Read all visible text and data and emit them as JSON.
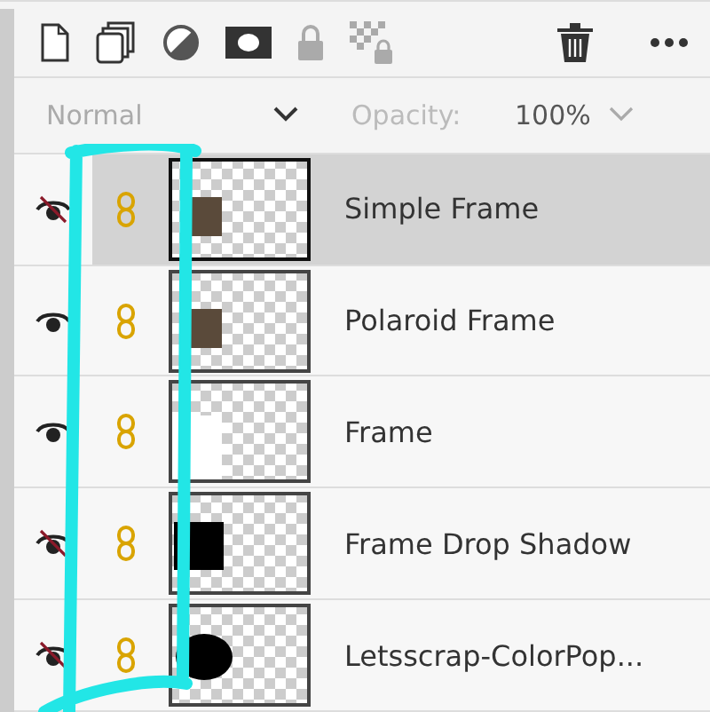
{
  "toolbar": {
    "opacity_label": "Opacity:",
    "opacity_value": "100%",
    "blend_mode": "Normal"
  },
  "layers": [
    {
      "name": "Simple Frame",
      "visible": false,
      "selected": true,
      "kind": "photo"
    },
    {
      "name": "Polaroid Frame",
      "visible": true,
      "selected": false,
      "kind": "photo"
    },
    {
      "name": "Frame",
      "visible": true,
      "selected": false,
      "kind": "white"
    },
    {
      "name": "Frame Drop Shadow",
      "visible": false,
      "selected": false,
      "kind": "square"
    },
    {
      "name": "Letsscrap-ColorPop...",
      "visible": false,
      "selected": false,
      "kind": "blob"
    }
  ]
}
